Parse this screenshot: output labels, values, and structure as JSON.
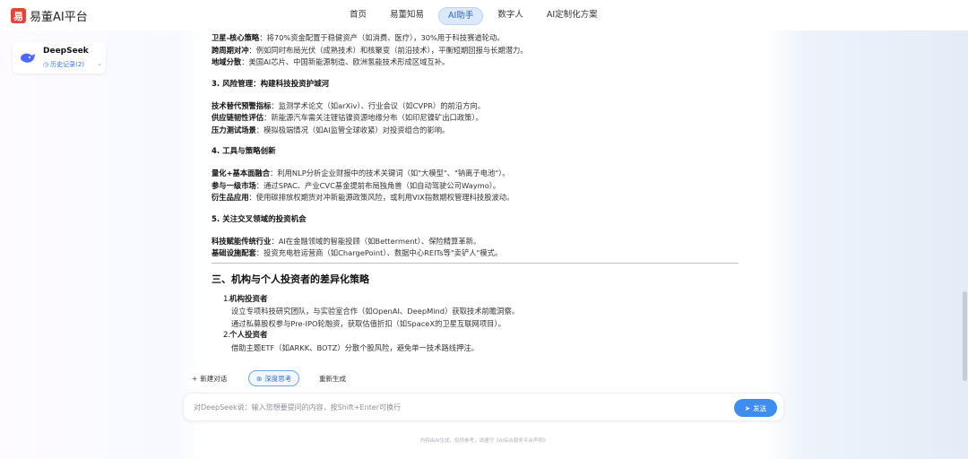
{
  "app": {
    "logo_mark": "易",
    "title": "易董AI平台"
  },
  "nav": {
    "items": [
      "首页",
      "易董知易",
      "AI助手",
      "数字人",
      "AI定制化方案"
    ],
    "active_index": 2
  },
  "sidebar": {
    "bot_name": "DeepSeek",
    "history_label": "历史记录(2)"
  },
  "content": {
    "top_lines": [
      {
        "bold": "卫星-核心策略",
        "text": "：将70%资金配置于稳健资产（如消费、医疗），30%用于科技赛道轮动。"
      },
      {
        "bold": "跨周期对冲",
        "text": "：例如同时布局光伏（成熟技术）和核聚变（前沿技术），平衡短期回报与长期潜力。"
      },
      {
        "bold": "地域分散",
        "text": "：美国AI芯片、中国新能源制造、欧洲氢能技术形成区域互补。"
      }
    ],
    "section3": {
      "title": "3. 风险管理：构建科技投资护城河",
      "lines": [
        {
          "bold": "技术替代预警指标",
          "text": "：监测学术论文（如arXiv）、行业会议（如CVPR）的前沿方向。"
        },
        {
          "bold": "供应链韧性评估",
          "text": "：新能源汽车需关注锂钴镍资源地缘分布（如印尼镍矿出口政策）。"
        },
        {
          "bold": "压力测试场景",
          "text": "：模拟极端情况（如AI监管全球收紧）对投资组合的影响。"
        }
      ]
    },
    "section4": {
      "title": "4. 工具与策略创新",
      "lines": [
        {
          "bold": "量化+基本面融合",
          "text": "：利用NLP分析企业财报中的技术关键词（如\"大模型\"、\"钠离子电池\"）。"
        },
        {
          "bold": "参与一级市场",
          "text": "：通过SPAC、产业CVC基金提前布局独角兽（如自动驾驶公司Waymo）。"
        },
        {
          "bold": "衍生品应用",
          "text": "：使用碳排放权期货对冲新能源政策风险，或利用VIX指数期权管理科技股波动。"
        }
      ]
    },
    "section5": {
      "title": "5. 关注交叉领域的投资机会",
      "lines": [
        {
          "bold": "科技赋能传统行业",
          "text": "：AI在金融领域的智能投顾（如Betterment）、保险精算革新。"
        },
        {
          "bold": "基础设施配套",
          "text": "：投资充电桩运营商（如ChargePoint）、数据中心REITs等\"卖铲人\"模式。"
        }
      ]
    },
    "heading3": "三、机构与个人投资者的差异化策略",
    "list": [
      {
        "num": "1.",
        "title": "机构投资者",
        "subs": [
          "设立专项科技研究团队，与实验室合作（如OpenAI、DeepMind）获取技术前瞻洞察。",
          "通过私募股权参与Pre-IPO轮融资，获取估值折扣（如SpaceX的卫星互联网项目）。"
        ]
      },
      {
        "num": "2.",
        "title": "个人投资者",
        "subs": [
          "借助主题ETF（如ARKK、BOTZ）分散个股风险，避免单一技术路线押注。"
        ]
      }
    ]
  },
  "actions": {
    "new_chat": "新建对话",
    "deep_think": "深度思考",
    "regenerate": "重新生成"
  },
  "input": {
    "placeholder": "对DeepSeek说：输入您想要提问的内容，按Shift+Enter可换行",
    "send": "发送"
  },
  "footer": "内容由AI生成，仅供参考，请遵守《AI综合服务平台声明》",
  "colors": {
    "accent": "#3d8ef0",
    "logo": "#e0463a",
    "nav_active_bg": "#dbe9fb"
  }
}
